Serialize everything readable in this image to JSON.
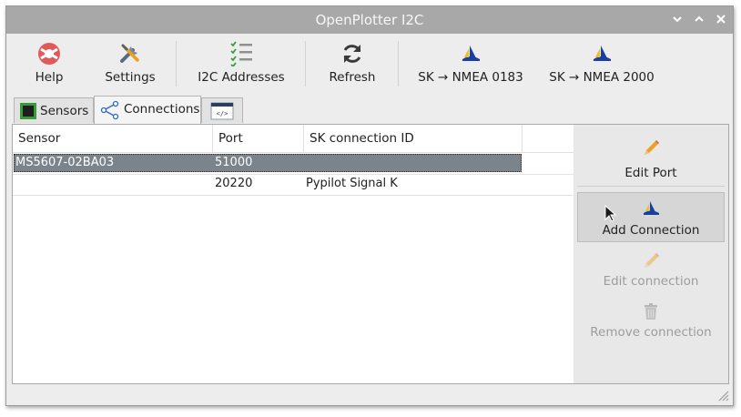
{
  "window": {
    "title": "OpenPlotter I2C"
  },
  "toolbar": {
    "help": "Help",
    "settings": "Settings",
    "i2c_addresses": "I2C Addresses",
    "refresh": "Refresh",
    "sk_nmea0183": "SK → NMEA 0183",
    "sk_nmea2000": "SK → NMEA 2000"
  },
  "tabs": [
    {
      "label": "Sensors"
    },
    {
      "label": "Connections"
    },
    {
      "label": ""
    }
  ],
  "table": {
    "columns": [
      "Sensor",
      "Port",
      "SK connection ID"
    ],
    "rows": [
      {
        "sensor": "MS5607-02BA03",
        "port": "51000",
        "sk_id": "",
        "selected": true
      },
      {
        "sensor": "",
        "port": "20220",
        "sk_id": "Pypilot Signal K",
        "selected": false
      }
    ]
  },
  "actions": {
    "edit_port": "Edit Port",
    "add_connection": "Add Connection",
    "edit_connection": "Edit connection",
    "remove_connection": "Remove connection"
  },
  "colors": {
    "titlebar": "#a8a8a8",
    "selection": "#7b838b",
    "help_icon": "#e05a5a",
    "check_icon": "#3c9a3c",
    "signalk_icon": "#1b3fa0"
  }
}
